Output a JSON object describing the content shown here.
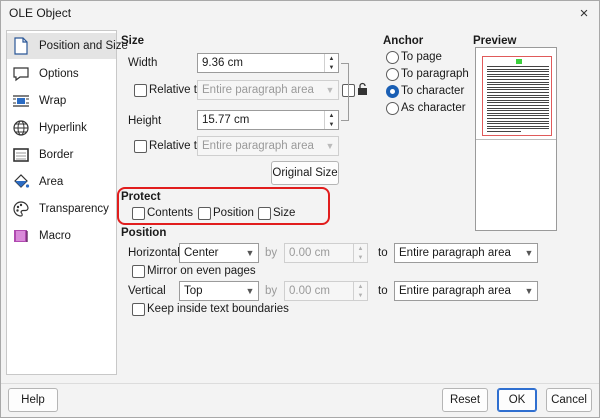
{
  "window": {
    "title": "OLE Object",
    "close_glyph": "×"
  },
  "sidebar": {
    "items": [
      {
        "label": "Position and Size",
        "icon": "page-icon",
        "active": true
      },
      {
        "label": "Options",
        "icon": "speech-bubble-icon"
      },
      {
        "label": "Wrap",
        "icon": "wrap-icon"
      },
      {
        "label": "Hyperlink",
        "icon": "globe-icon"
      },
      {
        "label": "Border",
        "icon": "border-icon"
      },
      {
        "label": "Area",
        "icon": "paint-bucket-icon"
      },
      {
        "label": "Transparency",
        "icon": "palette-icon"
      },
      {
        "label": "Macro",
        "icon": "macro-icon"
      }
    ]
  },
  "size": {
    "title": "Size",
    "width_label": "Width",
    "width_value": "9.36 cm",
    "relative_label": "Relative to",
    "relative_placeholder": "Entire paragraph area",
    "height_label": "Height",
    "height_value": "15.77 cm",
    "original_size_label": "Original Size"
  },
  "anchor": {
    "title": "Anchor",
    "options": [
      "To page",
      "To paragraph",
      "To character",
      "As character"
    ],
    "selected": "To character"
  },
  "preview": {
    "title": "Preview"
  },
  "protect": {
    "title": "Protect",
    "contents_label": "Contents",
    "position_label": "Position",
    "size_label": "Size"
  },
  "position": {
    "title": "Position",
    "horizontal_label": "Horizontal",
    "horizontal_value": "Center",
    "by_label": "by",
    "horizontal_by_value": "0.00 cm",
    "to_label": "to",
    "horizontal_to_value": "Entire paragraph area",
    "mirror_label": "Mirror on even pages",
    "vertical_label": "Vertical",
    "vertical_value": "Top",
    "vertical_by_value": "0.00 cm",
    "vertical_to_value": "Entire paragraph area",
    "keep_inside_label": "Keep inside text boundaries"
  },
  "buttons": {
    "help": "Help",
    "reset": "Reset",
    "ok": "OK",
    "cancel": "Cancel"
  },
  "colors": {
    "highlight": "#e11d1d",
    "radio_selected": "#1a5fb4",
    "preview_frame": "#e05a5a",
    "preview_marker": "#3dd13d"
  }
}
